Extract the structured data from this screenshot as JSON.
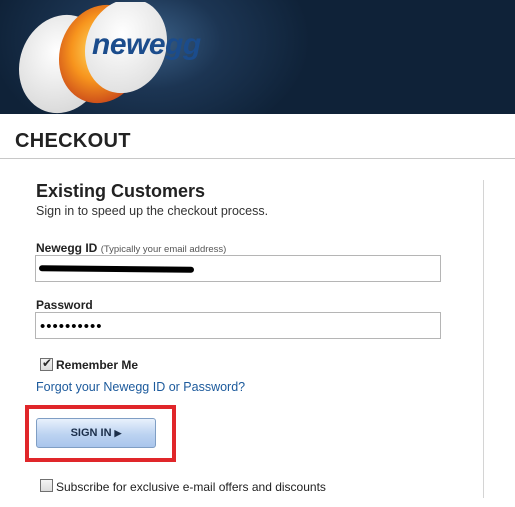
{
  "header": {
    "logo_text": "newegg"
  },
  "checkout": {
    "title": "CHECKOUT",
    "section_title": "Existing Customers",
    "section_subtitle": "Sign in to speed up the checkout process.",
    "newegg_id": {
      "label": "Newegg ID",
      "hint": "(Typically your email address)",
      "value": ""
    },
    "password": {
      "label": "Password",
      "value": "••••••••••"
    },
    "remember_me": {
      "label": "Remember Me",
      "checked": true
    },
    "forgot_link": "Forgot your Newegg ID or Password?",
    "signin_label": "SIGN IN",
    "signin_icon": "play-arrow-icon",
    "subscribe": {
      "label": "Subscribe for exclusive e-mail offers and discounts",
      "checked": false
    },
    "highlight_color": "#e0262a"
  }
}
